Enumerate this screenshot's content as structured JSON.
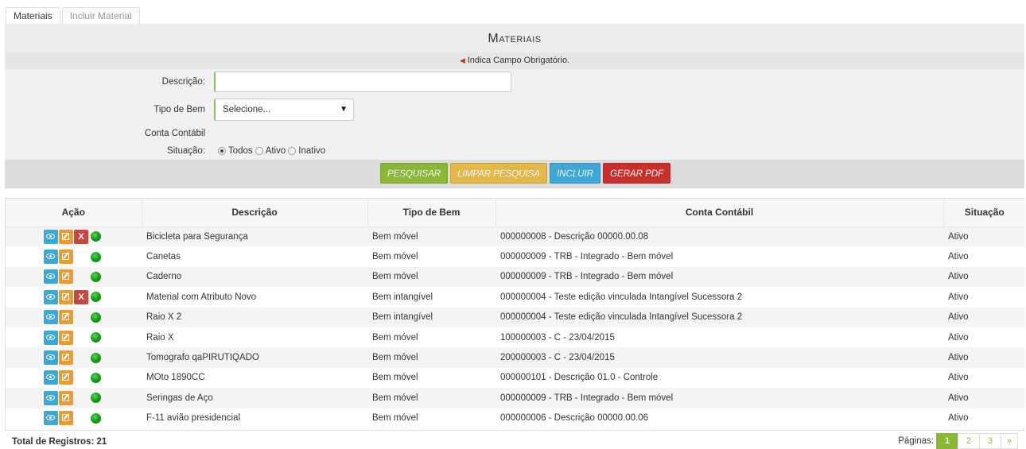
{
  "tabs": [
    {
      "label": "Materiais",
      "active": true
    },
    {
      "label": "Incluir Material",
      "active": false
    }
  ],
  "panel": {
    "title": "Materiais",
    "required_note": "Indica Campo Obrigatório.",
    "fields": {
      "descricao_label": "Descrição:",
      "descricao_value": "",
      "tipo_label": "Tipo de Bem",
      "tipo_selected": "Selecione...",
      "conta_label": "Conta Contábil",
      "situacao_label": "Situação:",
      "situacao_options": [
        "Todos",
        "Ativo",
        "Inativo"
      ],
      "situacao_selected": "Todos"
    },
    "buttons": {
      "pesquisar": "PESQUISAR",
      "limpar": "LIMPAR PESQUISA",
      "incluir": "INCLUIR",
      "gerar_pdf": "GERAR PDF"
    }
  },
  "table": {
    "columns": [
      "Ação",
      "Descrição",
      "Tipo de Bem",
      "Conta Contábil",
      "Situação"
    ],
    "rows": [
      {
        "descricao": "Bicicleta para Segurança",
        "tipo": "Bem móvel",
        "conta": "000000008 - Descrição 00000.00.08",
        "situacao": "Ativo",
        "deletable": true
      },
      {
        "descricao": "Canetas",
        "tipo": "Bem móvel",
        "conta": "000000009 - TRB - Integrado - Bem móvel",
        "situacao": "Ativo",
        "deletable": false
      },
      {
        "descricao": "Caderno",
        "tipo": "Bem móvel",
        "conta": "000000009 - TRB - Integrado - Bem móvel",
        "situacao": "Ativo",
        "deletable": false
      },
      {
        "descricao": "Material com Atributo Novo",
        "tipo": "Bem intangível",
        "conta": "000000004 - Teste edição vinculada Intangível Sucessora 2",
        "situacao": "Ativo",
        "deletable": true
      },
      {
        "descricao": "Raio X 2",
        "tipo": "Bem intangível",
        "conta": "000000004 - Teste edição vinculada Intangível Sucessora 2",
        "situacao": "Ativo",
        "deletable": false
      },
      {
        "descricao": "Raio X",
        "tipo": "Bem móvel",
        "conta": "100000003 - C - 23/04/2015",
        "situacao": "Ativo",
        "deletable": false
      },
      {
        "descricao": "Tomografo qaPIRUTIQADO",
        "tipo": "Bem móvel",
        "conta": "200000003 - C - 23/04/2015",
        "situacao": "Ativo",
        "deletable": false
      },
      {
        "descricao": "MOto 1890CC",
        "tipo": "Bem móvel",
        "conta": "000000101 - Descrição 01.0 - Controle",
        "situacao": "Ativo",
        "deletable": false
      },
      {
        "descricao": "Seringas de Aço",
        "tipo": "Bem móvel",
        "conta": "000000009 - TRB - Integrado - Bem móvel",
        "situacao": "Ativo",
        "deletable": false
      },
      {
        "descricao": "F-11 avião presidencial",
        "tipo": "Bem móvel",
        "conta": "000000006 - Descrição 00000.00.06",
        "situacao": "Ativo",
        "deletable": false
      }
    ],
    "delete_glyph": "X"
  },
  "footer": {
    "total_label": "Total de Registros: 21",
    "pages_label": "Páginas:",
    "pages": [
      "1",
      "2",
      "3"
    ],
    "current_page": "1",
    "next_label": "»"
  },
  "icons": {
    "view": "eye-icon",
    "edit": "edit-icon",
    "delete": "delete-icon",
    "status": "status-active-icon",
    "required": "required-marker-icon",
    "dropdown": "caret-down-icon"
  },
  "colors": {
    "pesquisar": "#8bb834",
    "limpar": "#e5b949",
    "incluir": "#3ba8d6",
    "gerar_pdf": "#c9302c",
    "status_active": "#18a118"
  }
}
